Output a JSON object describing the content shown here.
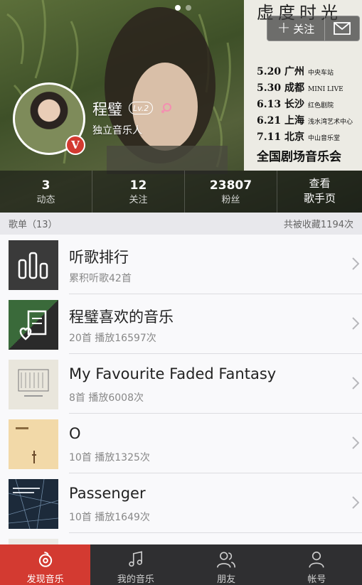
{
  "poster": {
    "title": "虚度时光",
    "tour": [
      {
        "date": "5.20 广州",
        "venue": "中央车站"
      },
      {
        "date": "5.30 成都",
        "venue": "MINI LIVE"
      },
      {
        "date": "6.13 长沙",
        "venue": "红色剧院"
      },
      {
        "date": "6.21 上海",
        "venue": "浅水湾艺术中心"
      },
      {
        "date": "7.11 北京",
        "venue": "中山音乐堂"
      }
    ],
    "footer": "全国剧场音乐会"
  },
  "carousel": {
    "count": 2,
    "active": 0
  },
  "header": {
    "follow_label": "关注",
    "message_icon": "envelope-icon",
    "artist_name": "程璧",
    "level": "Lv.2",
    "gender_icon": "female-icon",
    "description": "独立音乐人",
    "verified_badge": "V"
  },
  "stats": {
    "items": [
      {
        "value": "3",
        "label": "动态"
      },
      {
        "value": "12",
        "label": "关注"
      },
      {
        "value": "23807",
        "label": "粉丝"
      }
    ],
    "homepage_line1": "查看",
    "homepage_line2": "歌手页"
  },
  "section": {
    "title": "歌单（13）",
    "total": "共被收藏1194次"
  },
  "playlists": [
    {
      "title": "听歌排行",
      "sub": "累积听歌42首",
      "cover": "ranking-cover"
    },
    {
      "title": "程璧喜欢的音乐",
      "sub": "20首 播放16597次",
      "cover": "liked-music-cover"
    },
    {
      "title": "My Favourite Faded Fantasy",
      "sub": "8首 播放6008次",
      "cover": "album-cover"
    },
    {
      "title": "O",
      "sub": "10首 播放1325次",
      "cover": "album-cover"
    },
    {
      "title": "Passenger",
      "sub": "10首 播放1649次",
      "cover": "album-cover"
    }
  ],
  "tabbar": {
    "items": [
      {
        "label": "发现音乐",
        "icon": "discover-music-icon"
      },
      {
        "label": "我的音乐",
        "icon": "music-note-icon"
      },
      {
        "label": "朋友",
        "icon": "friends-icon"
      },
      {
        "label": "帐号",
        "icon": "account-icon"
      }
    ],
    "active_index": 0
  },
  "colors": {
    "accent": "#d33a31",
    "tabbar": "#2f2f31"
  }
}
